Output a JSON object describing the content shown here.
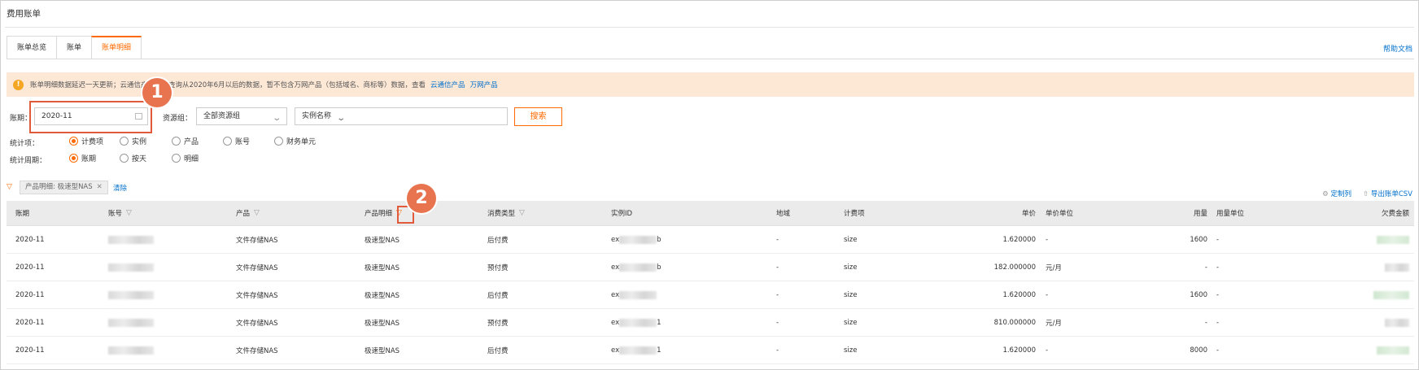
{
  "page": {
    "title": "费用账单"
  },
  "tabs": [
    {
      "label": "账单总览",
      "active": false
    },
    {
      "label": "账单",
      "active": false
    },
    {
      "label": "账单明细",
      "active": true
    }
  ],
  "help_link": "帮助文档",
  "notice": {
    "text": "账单明细数据延迟一天更新；云通信产品支持查询从2020年6月以后的数据，暂不包含万网产品（包括域名、商标等）数据，查看",
    "link1": "云通信产品",
    "link2": "万网产品"
  },
  "filters": {
    "period_label": "账期：",
    "period_value": "2020-11",
    "resource_group_label": "资源组：",
    "resource_group_value": "全部资源组",
    "instance_name_placeholder": "实例名称",
    "search_button": "搜索"
  },
  "stat_item": {
    "label": "统计项：",
    "options": [
      "计费项",
      "实例",
      "产品",
      "账号",
      "财务单元"
    ],
    "selected": "计费项"
  },
  "stat_period": {
    "label": "统计周期：",
    "options": [
      "账期",
      "按天",
      "明细"
    ],
    "selected": "账期"
  },
  "active_filter": {
    "chip": "产品明细: 极速型NAS",
    "clear": "清除"
  },
  "actions": {
    "customize": "定制列",
    "export": "导出账单CSV"
  },
  "table": {
    "headers": [
      "账期",
      "账号",
      "产品",
      "产品明细",
      "消费类型",
      "实例ID",
      "地域",
      "计费项",
      "单价",
      "单价单位",
      "用量",
      "用量单位",
      "欠费金额"
    ],
    "rows": [
      {
        "period": "2020-11",
        "product": "文件存储NAS",
        "detail": "极速型NAS",
        "type": "后付费",
        "instance_prefix": "ex",
        "instance_suffix": "b",
        "region": "-",
        "item": "size",
        "price": "1.620000",
        "price_unit": "-",
        "usage": "1600",
        "usage_unit": "-"
      },
      {
        "period": "2020-11",
        "product": "文件存储NAS",
        "detail": "极速型NAS",
        "type": "预付费",
        "instance_prefix": "ex",
        "instance_suffix": "b",
        "region": "-",
        "item": "size",
        "price": "182.000000",
        "price_unit": "元/月",
        "usage": "-",
        "usage_unit": "-"
      },
      {
        "period": "2020-11",
        "product": "文件存储NAS",
        "detail": "极速型NAS",
        "type": "后付费",
        "instance_prefix": "ex",
        "instance_suffix": "",
        "region": "-",
        "item": "size",
        "price": "1.620000",
        "price_unit": "-",
        "usage": "1600",
        "usage_unit": "-"
      },
      {
        "period": "2020-11",
        "product": "文件存储NAS",
        "detail": "极速型NAS",
        "type": "预付费",
        "instance_prefix": "ex",
        "instance_suffix": "1",
        "region": "-",
        "item": "size",
        "price": "810.000000",
        "price_unit": "元/月",
        "usage": "-",
        "usage_unit": "-"
      },
      {
        "period": "2020-11",
        "product": "文件存储NAS",
        "detail": "极速型NAS",
        "type": "后付费",
        "instance_prefix": "ex",
        "instance_suffix": "1",
        "region": "-",
        "item": "size",
        "price": "1.620000",
        "price_unit": "-",
        "usage": "8000",
        "usage_unit": "-"
      }
    ]
  },
  "callouts": [
    "1",
    "2"
  ],
  "colors": {
    "accent": "#ff6a00",
    "link": "#0070cc",
    "callout": "#e8734f",
    "notice_bg": "#fde8d6"
  }
}
